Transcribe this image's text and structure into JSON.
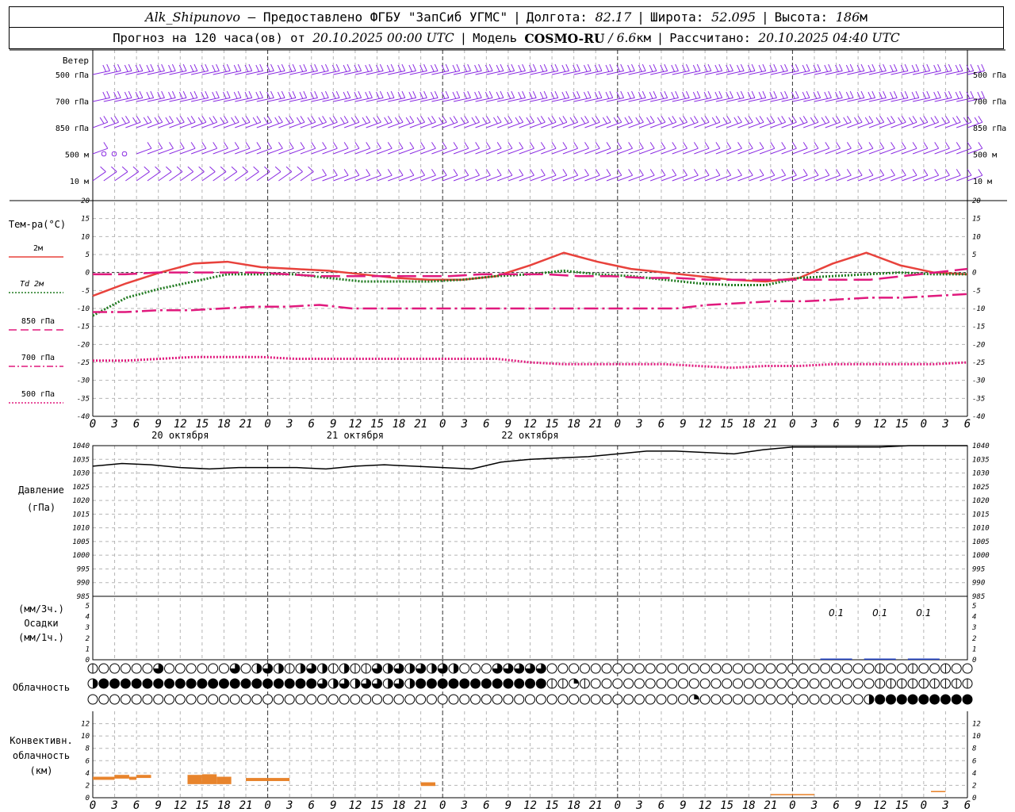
{
  "header": {
    "station": "Alk_Shipunovo",
    "dash": " – ",
    "provider": "Предоставлено ФГБУ \"ЗапСиб УГМС\"",
    "sep": "|",
    "lon_label": "Долгота:",
    "lon_value": "82.17",
    "lat_label": "Широта:",
    "lat_value": "52.095",
    "alt_label": "Высота:",
    "alt_value": "186",
    "alt_unit": "м"
  },
  "subheader": {
    "forecast_text": "Прогноз на 120 часа(ов) от",
    "forecast_time": "20.10.2025 00:00 UTC",
    "model_label": "Модель",
    "model_name": "COSMO-RU",
    "model_res_sep": " / ",
    "model_res": "6.6",
    "model_res_unit": "км",
    "calc_label": "Рассчитано:",
    "calc_time": "20.10.2025 04:40 UTC"
  },
  "chart_data": [
    {
      "type": "barbs",
      "panel": "wind",
      "title": "Ветер",
      "levels": [
        "500 гПа",
        "700 гПа",
        "850 гПа",
        "500 м",
        "10 м"
      ],
      "color": "#8a2be2"
    },
    {
      "type": "line",
      "panel": "temperature",
      "ylabel": "Тем-ра(°C)",
      "ylim": [
        -40,
        20
      ],
      "yticks": [
        20,
        15,
        10,
        5,
        0,
        -5,
        -10,
        -15,
        -20,
        -25,
        -30,
        -35,
        -40
      ],
      "x_hours": [
        0,
        3,
        6,
        9,
        12,
        15,
        18,
        21,
        24,
        27,
        30,
        33,
        36,
        39,
        42,
        45,
        48,
        51,
        54,
        57,
        60,
        63,
        66,
        69,
        72,
        75,
        78
      ],
      "series": [
        {
          "name": "2м",
          "color": "#e8423c",
          "style": "solid",
          "values": [
            -6.5,
            -3,
            0,
            2.5,
            3,
            1.5,
            1,
            0.5,
            -0.5,
            -1.5,
            -2,
            -2,
            -1,
            2,
            5.5,
            3,
            1,
            0,
            -1,
            -2,
            -2.5,
            -1.5,
            2.5,
            5.5,
            2,
            0,
            -0.5
          ]
        },
        {
          "name": "Td 2м",
          "color": "#1f7a1f",
          "style": "dotted",
          "values": [
            -12,
            -7,
            -4.5,
            -2.5,
            -0.5,
            -0.5,
            -0.5,
            -1.5,
            -2.5,
            -2.5,
            -2.5,
            -2,
            -1,
            -0.5,
            0.5,
            -0.5,
            -1,
            -2,
            -3,
            -3.5,
            -3.5,
            -1.5,
            -1,
            -0.5,
            0,
            -0.5,
            -0.5
          ]
        },
        {
          "name": "850 гПа",
          "color": "#e0197d",
          "style": "dashed",
          "values": [
            -0.5,
            -0.5,
            0,
            0,
            0,
            0,
            -0.5,
            -1,
            -1,
            -1,
            -1,
            -1,
            -0.5,
            -0.5,
            -0.5,
            -1,
            -1,
            -1.5,
            -1.5,
            -2,
            -2,
            -2,
            -2,
            -2,
            -2,
            -1,
            0,
            1
          ]
        },
        {
          "name": "700 гПа",
          "color": "#e0197d",
          "style": "dashdot",
          "values": [
            -11,
            -11,
            -10.5,
            -10.5,
            -10,
            -9.5,
            -9.5,
            -9,
            -10,
            -10,
            -10,
            -10,
            -10,
            -10,
            -10,
            -10,
            -10,
            -10,
            -10,
            -9,
            -8.5,
            -8,
            -8,
            -7.5,
            -7,
            -7,
            -6.5,
            -6
          ]
        },
        {
          "name": "500 гПа",
          "color": "#e0197d",
          "style": "dotted",
          "values": [
            -24.5,
            -24.5,
            -24,
            -23.5,
            -23.5,
            -23.5,
            -24,
            -24,
            -24,
            -24,
            -24,
            -24,
            -24,
            -25,
            -25.5,
            -25.5,
            -25.5,
            -25.5,
            -26,
            -26.5,
            -26,
            -26,
            -25.5,
            -25.5,
            -25.5,
            -25.5,
            -25
          ]
        }
      ]
    },
    {
      "type": "line",
      "panel": "pressure",
      "ylabel": "Давление",
      "yunit": "(гПа)",
      "ylim": [
        985,
        1040
      ],
      "yticks": [
        1040,
        1035,
        1030,
        1025,
        1020,
        1015,
        1010,
        1005,
        1000,
        995,
        990,
        985
      ],
      "series": [
        {
          "name": "pressure",
          "color": "#000000",
          "values": [
            1032.5,
            1033.5,
            1033,
            1032,
            1031.5,
            1032,
            1032,
            1032,
            1031.5,
            1032.5,
            1033,
            1032.5,
            1032,
            1031.5,
            1034,
            1035,
            1035.5,
            1036,
            1037,
            1038,
            1038,
            1037.5,
            1037,
            1038.5,
            1039.5,
            1039.5,
            1039.5,
            1039.5,
            1040,
            1040,
            1040
          ]
        }
      ]
    },
    {
      "type": "bar",
      "panel": "precipitation",
      "ylabel": "Осадки",
      "unit_3h": "(мм/3ч.)",
      "unit_1h": "(мм/1ч.)",
      "ylim": [
        0,
        5
      ],
      "yticks": [
        5,
        4,
        3,
        2,
        1,
        0
      ],
      "labels": [
        {
          "hour": 102,
          "text": "0.1"
        },
        {
          "hour": 108,
          "text": "0.1"
        },
        {
          "hour": 114,
          "text": "0.1"
        }
      ]
    },
    {
      "type": "symbols",
      "panel": "cloudiness",
      "ylabel": "Облачность",
      "rows": [
        "upper",
        "middle",
        "lower"
      ]
    },
    {
      "type": "bar",
      "panel": "convective",
      "ylabel_lines": [
        "Конвективн.",
        "облачность",
        "(км)"
      ],
      "ylim": [
        0,
        14
      ],
      "yticks": [
        12,
        10,
        8,
        6,
        4,
        2,
        0
      ],
      "color": "#e8842c",
      "bars": [
        {
          "start": 0,
          "end": 3,
          "bottom": 2.9,
          "top": 3.4
        },
        {
          "start": 3,
          "end": 5,
          "bottom": 3.1,
          "top": 3.7
        },
        {
          "start": 5,
          "end": 6,
          "bottom": 2.9,
          "top": 3.4
        },
        {
          "start": 6,
          "end": 8,
          "bottom": 3.2,
          "top": 3.7
        },
        {
          "start": 13,
          "end": 15,
          "bottom": 2.2,
          "top": 3.7
        },
        {
          "start": 15,
          "end": 17,
          "bottom": 2.2,
          "top": 3.8
        },
        {
          "start": 17,
          "end": 19,
          "bottom": 2.2,
          "top": 3.4
        },
        {
          "start": 21,
          "end": 27,
          "bottom": 2.7,
          "top": 3.2
        },
        {
          "start": 45,
          "end": 47,
          "bottom": 1.9,
          "top": 2.5
        },
        {
          "start": 93,
          "end": 99,
          "bottom": 0.4,
          "top": 0.6
        },
        {
          "start": 115,
          "end": 117,
          "bottom": 0.9,
          "top": 1.1
        }
      ]
    }
  ],
  "time_axis": {
    "hours_total": 120,
    "hour_labels": [
      "0",
      "3",
      "6",
      "9",
      "12",
      "15",
      "18",
      "21"
    ],
    "end_labels": [
      "0",
      "3",
      "6"
    ],
    "dates": [
      "20 октября",
      "21 октября",
      "22 октября"
    ]
  }
}
